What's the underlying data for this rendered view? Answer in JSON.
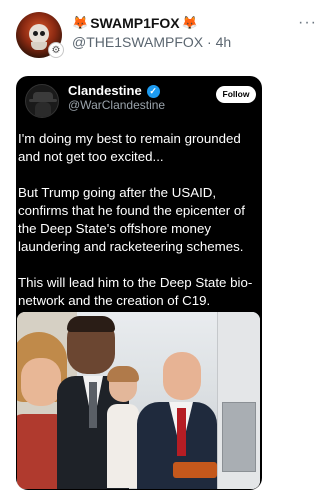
{
  "post": {
    "author": {
      "display_name": "SWAMP1FOX",
      "emoji_left": "🦊",
      "emoji_right": "🦊",
      "handle": "@THE1SWAMPFOX",
      "separator": " · ",
      "time": "4h"
    },
    "more_glyph": "···"
  },
  "quoted": {
    "author": {
      "name": "Clandestine",
      "verified_glyph": "✓",
      "handle": "@WarClandestine"
    },
    "follow_label": "Follow",
    "paragraphs": [
      "I'm doing my best to remain grounded and not get too excited...",
      "But Trump going after the USAID, confirms that he found the epicenter of the Deep State's offshore money laundering and racketeering schemes.",
      "This will lead him to the Deep State bio-network and the creation of C19."
    ]
  },
  "colors": {
    "accent": "#1d9bf0",
    "quote_bg": "#000000",
    "handle_gray": "#5b6670"
  }
}
